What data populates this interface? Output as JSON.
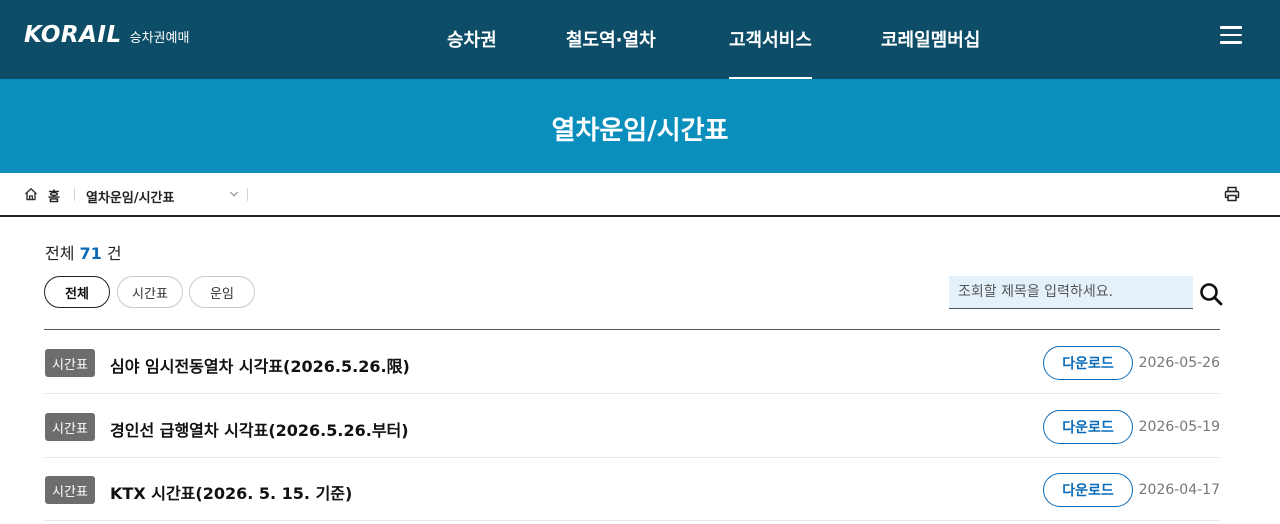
{
  "header": {
    "logo_text": "KORAIL",
    "logo_sub": "승차권예매",
    "nav": [
      "승차권",
      "철도역·열차",
      "고객서비스",
      "코레일멤버십"
    ],
    "active_nav": 2
  },
  "banner": {
    "title": "열차운임/시간표"
  },
  "breadcrumb": {
    "home": "홈",
    "current": "열차운임/시간표"
  },
  "summary": {
    "prefix": "전체",
    "count": "71",
    "suffix": "건"
  },
  "filters": [
    "전체",
    "시간표",
    "운임"
  ],
  "search": {
    "placeholder": "조회할 제목을 입력하세요."
  },
  "rows": [
    {
      "badge": "시간표",
      "title": "심야 임시전동열차 시각표(2026.5.26.限)",
      "button": "다운로드",
      "date": "2026-05-26"
    },
    {
      "badge": "시간표",
      "title": "경인선 급행열차 시각표(2026.5.26.부터)",
      "button": "다운로드",
      "date": "2026-05-19"
    },
    {
      "badge": "시간표",
      "title": "KTX 시간표(2026. 5. 15. 기준)",
      "button": "다운로드",
      "date": "2026-04-17"
    }
  ],
  "colors": {
    "header": "#0e4d68",
    "banner": "#0a8fbd",
    "accent": "#0b6bb8",
    "badge": "#6d6d6d"
  },
  "icons": [
    "menu-icon",
    "home-icon",
    "chevron-down-icon",
    "print-icon",
    "search-icon"
  ]
}
